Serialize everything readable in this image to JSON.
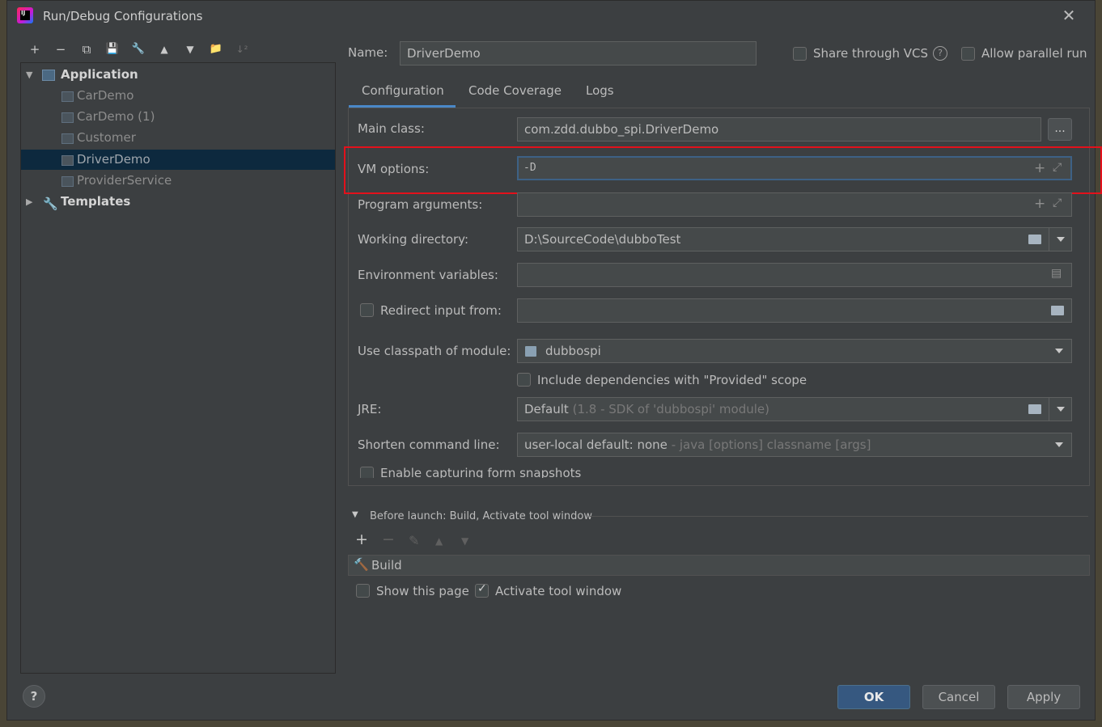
{
  "window": {
    "title": "Run/Debug Configurations",
    "close_glyph": "✕"
  },
  "toolbar": {
    "add": "+",
    "remove": "−",
    "copy": "⧉",
    "save": "💾",
    "settings": "🔧",
    "move_up": "▲",
    "move_down": "▼",
    "new_folder": "📁",
    "sort": "↓²"
  },
  "tree": {
    "root": "Application",
    "children": [
      "CarDemo",
      "CarDemo (1)",
      "Customer",
      "DriverDemo",
      "ProviderService"
    ],
    "selected": "DriverDemo",
    "templates": "Templates"
  },
  "header": {
    "name_label": "Name:",
    "name_value": "DriverDemo",
    "share_vcs": "Share through VCS",
    "allow_parallel": "Allow parallel run"
  },
  "tabs": [
    "Configuration",
    "Code Coverage",
    "Logs"
  ],
  "form": {
    "main_class_label": "Main class:",
    "main_class_value": "com.zdd.dubbo_spi.DriverDemo",
    "browse": "...",
    "vm_options_label": "VM options:",
    "vm_options_value": "-D",
    "program_args_label": "Program arguments:",
    "program_args_value": "",
    "working_dir_label": "Working directory:",
    "working_dir_value": "D:\\SourceCode\\dubboTest",
    "env_vars_label": "Environment variables:",
    "env_vars_value": "",
    "redirect_label": "Redirect input from:",
    "redirect_value": "",
    "classpath_label": "Use classpath of module:",
    "classpath_value": "dubbospi",
    "include_deps": "Include dependencies with \"Provided\" scope",
    "jre_label": "JRE:",
    "jre_value": "Default",
    "jre_hint": "(1.8 - SDK of 'dubbospi' module)",
    "shorten_label": "Shorten command line:",
    "shorten_value": "user-local default: none",
    "shorten_hint": "- java [options] classname [args]",
    "capture_snapshots": "Enable capturing form snapshots"
  },
  "before_launch": {
    "title": "Before launch: Build, Activate tool window",
    "build": "Build",
    "show_page": "Show this page",
    "activate_tool_window": "Activate tool window"
  },
  "buttons": {
    "help": "?",
    "ok": "OK",
    "cancel": "Cancel",
    "apply": "Apply"
  }
}
